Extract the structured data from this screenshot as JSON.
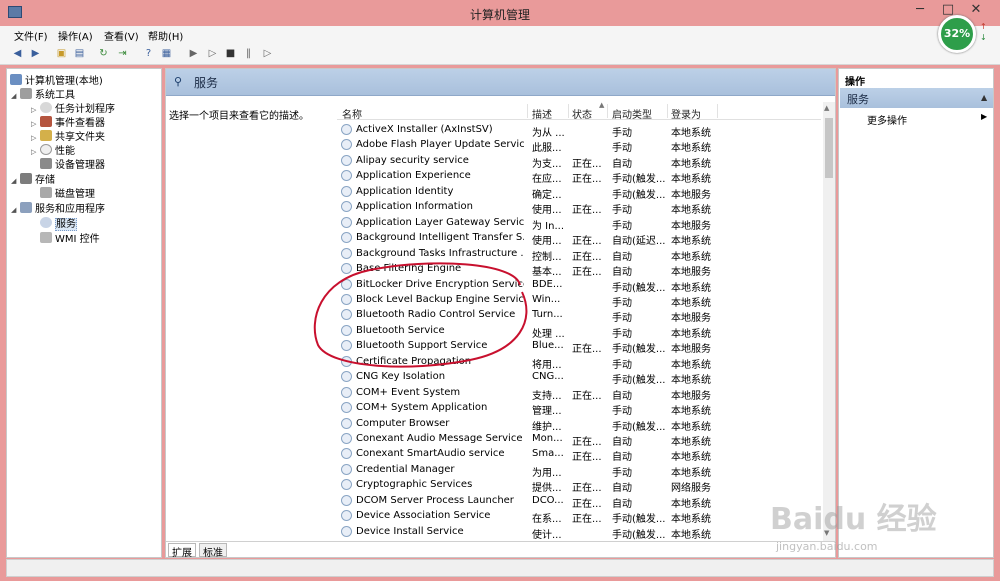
{
  "window": {
    "title": "计算机管理",
    "minimize": "─",
    "maximize": "□",
    "close": "✕"
  },
  "menu": [
    "文件(F)",
    "操作(A)",
    "查看(V)",
    "帮助(H)"
  ],
  "battery_badge": {
    "text": "32%",
    "up": "↑",
    "down": "↓",
    "color": "#2e9e4a"
  },
  "tree": {
    "root": "计算机管理(本地)",
    "system_tools": "系统工具",
    "task_scheduler": "任务计划程序",
    "event_viewer": "事件查看器",
    "shared_folders": "共享文件夹",
    "performance": "性能",
    "device_manager": "设备管理器",
    "storage": "存储",
    "disk_management": "磁盘管理",
    "services_apps": "服务和应用程序",
    "services": "服务",
    "wmi": "WMI 控件"
  },
  "center": {
    "header_title": "服务",
    "description": "选择一个项目来查看它的描述。",
    "columns": [
      "名称",
      "描述",
      "状态",
      "启动类型",
      "登录为"
    ],
    "rows": [
      [
        "ActiveX Installer (AxInstSV)",
        "为从 ...",
        "",
        "手动",
        "本地系统"
      ],
      [
        "Adobe Flash Player Update Service",
        "此服...",
        "",
        "手动",
        "本地系统"
      ],
      [
        "Alipay security service",
        "为支...",
        "正在...",
        "自动",
        "本地系统"
      ],
      [
        "Application Experience",
        "在应...",
        "正在...",
        "手动(触发...",
        "本地系统"
      ],
      [
        "Application Identity",
        "确定...",
        "",
        "手动(触发...",
        "本地服务"
      ],
      [
        "Application Information",
        "使用...",
        "正在...",
        "手动",
        "本地系统"
      ],
      [
        "Application Layer Gateway Service",
        "为 In...",
        "",
        "手动",
        "本地服务"
      ],
      [
        "Background Intelligent Transfer S...",
        "使用...",
        "正在...",
        "自动(延迟...",
        "本地系统"
      ],
      [
        "Background Tasks Infrastructure ...",
        "控制...",
        "正在...",
        "自动",
        "本地系统"
      ],
      [
        "Base Filtering Engine",
        "基本...",
        "正在...",
        "自动",
        "本地服务"
      ],
      [
        "BitLocker Drive Encryption Service",
        "BDE...",
        "",
        "手动(触发...",
        "本地系统"
      ],
      [
        "Block Level Backup Engine Service",
        "Win...",
        "",
        "手动",
        "本地系统"
      ],
      [
        "Bluetooth Radio Control Service",
        "Turn...",
        "",
        "手动",
        "本地服务"
      ],
      [
        "Bluetooth Service",
        "处理 ...",
        "",
        "手动",
        "本地系统"
      ],
      [
        "Bluetooth Support Service",
        "Blue...",
        "正在...",
        "手动(触发...",
        "本地服务"
      ],
      [
        "Certificate Propagation",
        "将用...",
        "",
        "手动",
        "本地系统"
      ],
      [
        "CNG Key Isolation",
        "CNG...",
        "",
        "手动(触发...",
        "本地系统"
      ],
      [
        "COM+ Event System",
        "支持...",
        "正在...",
        "自动",
        "本地服务"
      ],
      [
        "COM+ System Application",
        "管理...",
        "",
        "手动",
        "本地系统"
      ],
      [
        "Computer Browser",
        "维护...",
        "",
        "手动(触发...",
        "本地系统"
      ],
      [
        "Conexant Audio Message Service",
        "Mon...",
        "正在...",
        "自动",
        "本地系统"
      ],
      [
        "Conexant SmartAudio service",
        "Sma...",
        "正在...",
        "自动",
        "本地系统"
      ],
      [
        "Credential Manager",
        "为用...",
        "",
        "手动",
        "本地系统"
      ],
      [
        "Cryptographic Services",
        "提供...",
        "正在...",
        "自动",
        "网络服务"
      ],
      [
        "DCOM Server Process Launcher",
        "DCO...",
        "正在...",
        "自动",
        "本地系统"
      ],
      [
        "Device Association Service",
        "在系...",
        "正在...",
        "手动(触发...",
        "本地系统"
      ],
      [
        "Device Install Service",
        "使计...",
        "",
        "手动(触发...",
        "本地系统"
      ]
    ],
    "tabs": [
      "扩展",
      "标准"
    ]
  },
  "actions": {
    "title": "操作",
    "section": "服务",
    "more": "更多操作"
  },
  "watermark": {
    "logo": "Baidu 经验",
    "url": "jingyan.baidu.com"
  },
  "colors": {
    "window_frame": "#e99a9a",
    "header_blue": "#bcd0e7",
    "annotation_red": "#c8102e"
  }
}
